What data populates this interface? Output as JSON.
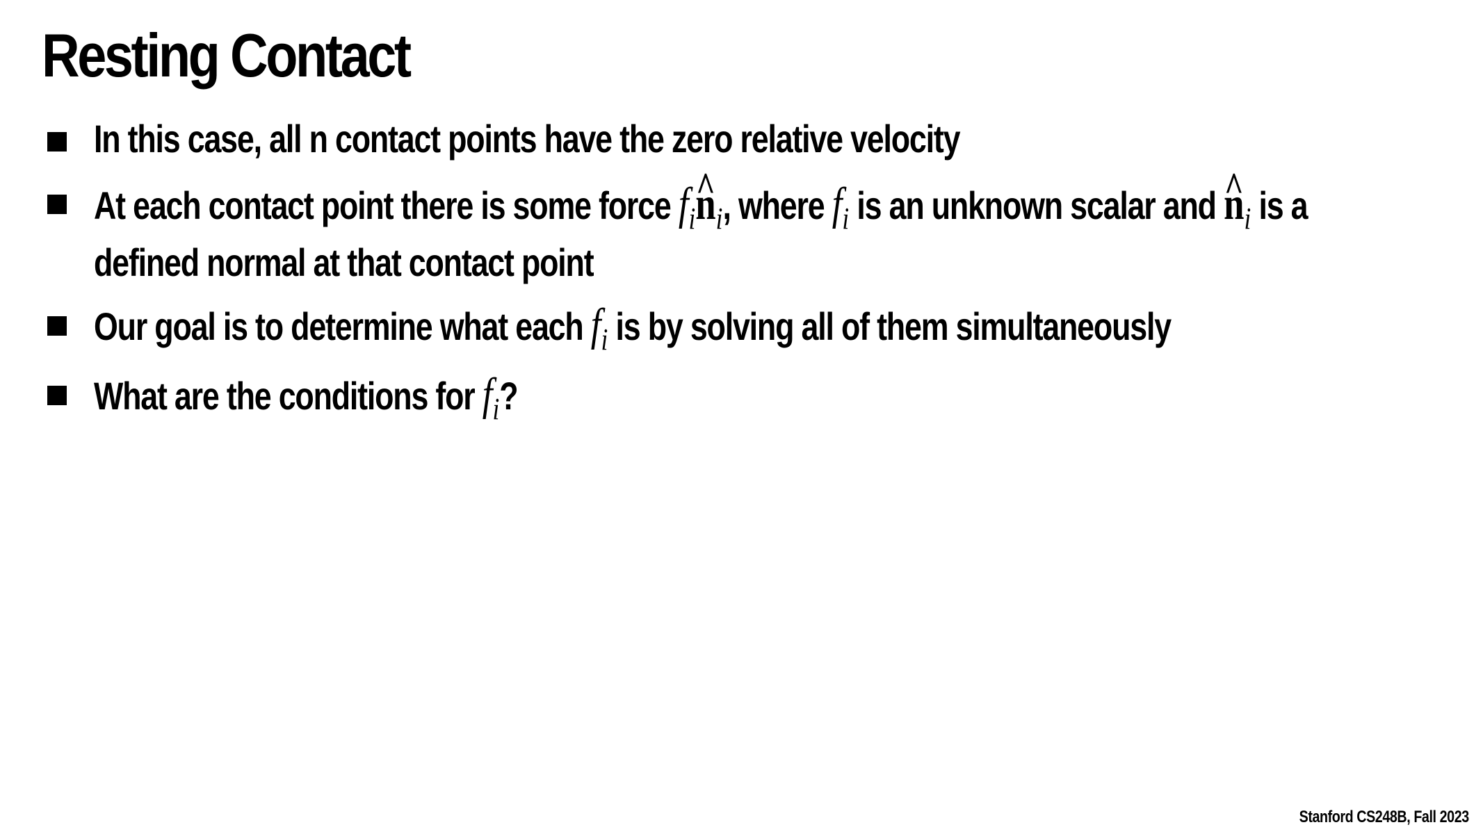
{
  "slide": {
    "title": "Resting Contact",
    "footer": "Stanford CS248B, Fall 2023",
    "bullets": [
      {
        "text": "In this case, all n contact points have the zero relative velocity"
      },
      {
        "text_before": "At each contact point there is some force ",
        "math_f": "f",
        "math_i": "i",
        "math_n": "n",
        "math_hat": "^",
        "text_mid1": ", where ",
        "text_mid2": " is an unknown scalar and ",
        "text_mid3": " is a",
        "text_line2": "defined normal at that contact point"
      },
      {
        "text_before": "Our goal is to determine what each ",
        "text_after": " is by solving all of them simultaneously"
      },
      {
        "text_before": "What are the conditions for ",
        "text_after": "?"
      }
    ]
  }
}
